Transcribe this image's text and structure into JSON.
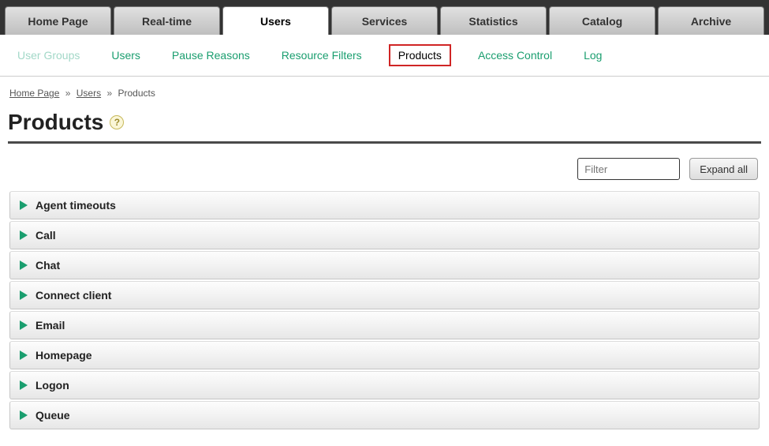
{
  "nav": {
    "main_tabs": [
      {
        "label": "Home Page",
        "active": false
      },
      {
        "label": "Real-time",
        "active": false
      },
      {
        "label": "Users",
        "active": true
      },
      {
        "label": "Services",
        "active": false
      },
      {
        "label": "Statistics",
        "active": false
      },
      {
        "label": "Catalog",
        "active": false
      },
      {
        "label": "Archive",
        "active": false
      }
    ],
    "sub_tabs": [
      {
        "label": "User Groups",
        "state": "disabled"
      },
      {
        "label": "Users",
        "state": "normal"
      },
      {
        "label": "Pause Reasons",
        "state": "normal"
      },
      {
        "label": "Resource Filters",
        "state": "normal"
      },
      {
        "label": "Products",
        "state": "active"
      },
      {
        "label": "Access Control",
        "state": "normal"
      },
      {
        "label": "Log",
        "state": "normal"
      }
    ]
  },
  "breadcrumb": {
    "items": [
      {
        "label": "Home Page",
        "link": true
      },
      {
        "label": "Users",
        "link": true
      },
      {
        "label": "Products",
        "link": false
      }
    ],
    "separator": "»"
  },
  "page": {
    "title": "Products",
    "help_glyph": "?"
  },
  "toolbar": {
    "filter_placeholder": "Filter",
    "expand_label": "Expand all"
  },
  "accordion": {
    "items": [
      {
        "label": "Agent timeouts"
      },
      {
        "label": "Call"
      },
      {
        "label": "Chat"
      },
      {
        "label": "Connect client"
      },
      {
        "label": "Email"
      },
      {
        "label": "Homepage"
      },
      {
        "label": "Logon"
      },
      {
        "label": "Queue"
      }
    ]
  }
}
